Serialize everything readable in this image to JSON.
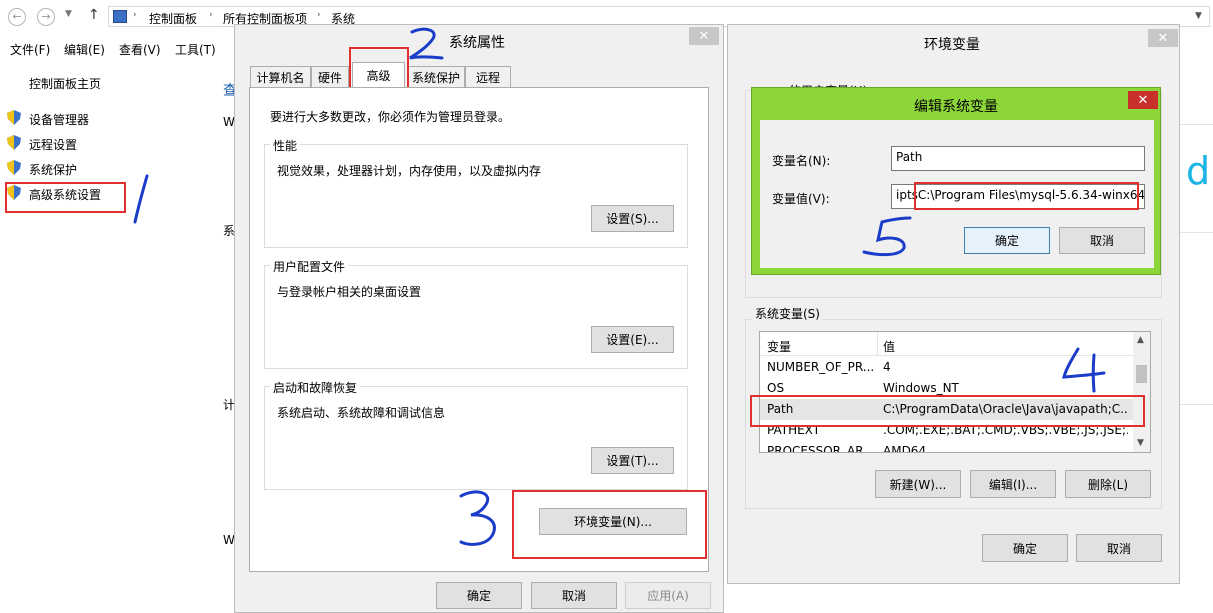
{
  "explorer": {
    "breadcrumb": [
      "控制面板",
      "所有控制面板项",
      "系统"
    ],
    "menu": [
      "文件(F)",
      "编辑(E)",
      "查看(V)",
      "工具(T)"
    ],
    "nav_home": "控制面板主页",
    "nav_items": [
      "设备管理器",
      "远程设置",
      "系统保护",
      "高级系统设置"
    ],
    "side_fragments": [
      "查",
      "W",
      "系",
      "计",
      "W"
    ]
  },
  "system_properties": {
    "title": "系统属性",
    "close": "✕",
    "tabs": [
      "计算机名",
      "硬件",
      "高级",
      "系统保护",
      "远程"
    ],
    "notice": "要进行大多数更改，你必须作为管理员登录。",
    "performance": {
      "label": "性能",
      "desc": "视觉效果，处理器计划，内存使用，以及虚拟内存",
      "button": "设置(S)..."
    },
    "profiles": {
      "label": "用户配置文件",
      "desc": "与登录帐户相关的桌面设置",
      "button": "设置(E)..."
    },
    "startup": {
      "label": "启动和故障恢复",
      "desc": "系统启动、系统故障和调试信息",
      "button": "设置(T)..."
    },
    "env_button": "环境变量(N)...",
    "ok": "确定",
    "cancel": "取消",
    "apply": "应用(A)"
  },
  "env_vars": {
    "title": "环境变量",
    "close": "✕",
    "user_vars_label": "的用户变量(U)",
    "system_vars_label": "系统变量(S)",
    "columns": {
      "name": "变量",
      "value": "值"
    },
    "rows": [
      {
        "name": "NUMBER_OF_PR...",
        "value": "4"
      },
      {
        "name": "OS",
        "value": "Windows_NT"
      },
      {
        "name": "Path",
        "value": "C:\\ProgramData\\Oracle\\Java\\javapath;C..."
      },
      {
        "name": "PATHEXT",
        "value": ".COM;.EXE;.BAT;.CMD;.VBS;.VBE;.JS;.JSE;..."
      },
      {
        "name": "PROCESSOR_AR...",
        "value": "AMD64"
      }
    ],
    "new": "新建(W)...",
    "edit": "编辑(I)...",
    "delete": "删除(L)",
    "ok": "确定",
    "cancel": "取消"
  },
  "edit_var": {
    "title": "编辑系统变量",
    "close": "✕",
    "name_label": "变量名(N):",
    "name_value": "Path",
    "value_label": "变量值(V):",
    "value_prefix": "ipts",
    "value_text": "C:\\Program Files\\mysql-5.6.34-winx64\\",
    "ok": "确定",
    "cancel": "取消"
  },
  "annotations": [
    "1",
    "2",
    "3",
    "4",
    "5"
  ],
  "colors": {
    "accent_green": "#8dd63a",
    "annotation_red": "#e03030",
    "annotation_blue": "#1a3cc8",
    "cyan_text": "#1ab4e6"
  }
}
